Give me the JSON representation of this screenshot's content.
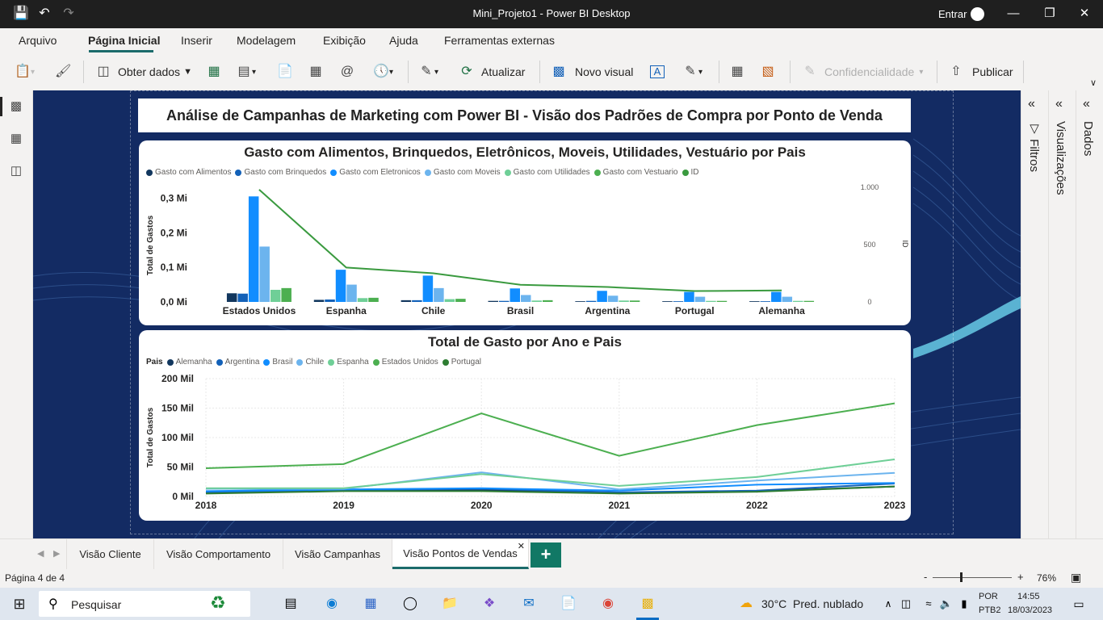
{
  "window": {
    "title": "Mini_Projeto1 - Power BI Desktop",
    "signin": "Entrar"
  },
  "menu": {
    "tabs": [
      "Arquivo",
      "Página Inicial",
      "Inserir",
      "Modelagem",
      "Exibição",
      "Ajuda",
      "Ferramentas externas"
    ]
  },
  "ribbon": {
    "get_data": "Obter dados",
    "refresh": "Atualizar",
    "new_visual": "Novo visual",
    "sensitivity": "Confidencialidade",
    "publish": "Publicar"
  },
  "report": {
    "title": "Análise de Campanhas de Marketing com Power BI - Visão dos Padrões de Compra por Ponto de Venda"
  },
  "chart_data": [
    {
      "type": "bar",
      "title": "Gasto com Alimentos, Brinquedos, Eletrônicos, Moveis, Utilidades, Vestuário por Pais",
      "ylabel": "Total de Gastos",
      "y2label": "ID",
      "ylim": [
        0,
        0.35
      ],
      "y_ticks": [
        "0,0 Mi",
        "0,1 Mi",
        "0,2 Mi",
        "0,3 Mi"
      ],
      "y2lim": [
        0,
        1000
      ],
      "y2_ticks": [
        "0",
        "500",
        "1.000"
      ],
      "categories": [
        "Estados Unidos",
        "Espanha",
        "Chile",
        "Brasil",
        "Argentina",
        "Portugal",
        "Alemanha"
      ],
      "series": [
        {
          "name": "Gasto com Alimentos",
          "color": "#12375e",
          "values": [
            0.025,
            0.006,
            0.005,
            0.003,
            0.002,
            0.002,
            0.002
          ]
        },
        {
          "name": "Gasto com Brinquedos",
          "color": "#1361b8",
          "values": [
            0.024,
            0.007,
            0.005,
            0.003,
            0.003,
            0.002,
            0.002
          ]
        },
        {
          "name": "Gasto com Eletronicos",
          "color": "#118dff",
          "values": [
            0.305,
            0.093,
            0.076,
            0.039,
            0.032,
            0.029,
            0.029
          ]
        },
        {
          "name": "Gasto com Moveis",
          "color": "#6cb4ee",
          "values": [
            0.16,
            0.05,
            0.04,
            0.02,
            0.018,
            0.015,
            0.015
          ]
        },
        {
          "name": "Gasto com Utilidades",
          "color": "#6fcf97",
          "values": [
            0.035,
            0.011,
            0.008,
            0.004,
            0.004,
            0.003,
            0.003
          ]
        },
        {
          "name": "Gasto com Vestuario",
          "color": "#4caf50",
          "values": [
            0.04,
            0.012,
            0.009,
            0.005,
            0.004,
            0.003,
            0.003
          ]
        }
      ],
      "line_series": {
        "name": "ID",
        "color": "#3a9a3f",
        "values": [
          980,
          300,
          250,
          150,
          130,
          95,
          100
        ]
      }
    },
    {
      "type": "line",
      "title": "Total de Gasto por Ano e Pais",
      "ylabel": "Total de Gastos",
      "legend_title": "Pais",
      "x": [
        "2018",
        "2019",
        "2020",
        "2021",
        "2022",
        "2023"
      ],
      "ylim": [
        0,
        200
      ],
      "y_ticks": [
        "0 Mil",
        "50 Mil",
        "100 Mil",
        "150 Mil",
        "200 Mil"
      ],
      "series": [
        {
          "name": "Alemanha",
          "color": "#12375e",
          "values": [
            6,
            10,
            11,
            6,
            9,
            17
          ]
        },
        {
          "name": "Argentina",
          "color": "#1361b8",
          "values": [
            7,
            11,
            13,
            7,
            10,
            22
          ]
        },
        {
          "name": "Brasil",
          "color": "#118dff",
          "values": [
            9,
            12,
            14,
            10,
            20,
            23
          ]
        },
        {
          "name": "Chile",
          "color": "#6cb4ee",
          "values": [
            13,
            13,
            41,
            12,
            27,
            40
          ]
        },
        {
          "name": "Espanha",
          "color": "#6fcf97",
          "values": [
            14,
            14,
            38,
            18,
            33,
            63
          ]
        },
        {
          "name": "Estados Unidos",
          "color": "#4caf50",
          "values": [
            48,
            55,
            141,
            69,
            121,
            158
          ]
        },
        {
          "name": "Portugal",
          "color": "#2e7d32",
          "values": [
            5,
            9,
            9,
            5,
            8,
            17
          ]
        }
      ]
    }
  ],
  "panes": {
    "filters": "Filtros",
    "visualizations": "Visualizações",
    "data": "Dados"
  },
  "page_tabs": [
    "Visão Cliente",
    "Visão Comportamento",
    "Visão Campanhas",
    "Visão Pontos de Vendas"
  ],
  "status": {
    "page": "Página 4 de 4",
    "zoom": "76%"
  },
  "taskbar": {
    "search": "Pesquisar",
    "weather": "30°C",
    "weather_desc": "Pred. nublado",
    "lang": "POR",
    "layout": "PTB2",
    "time": "14:55",
    "date": "18/03/2023"
  }
}
